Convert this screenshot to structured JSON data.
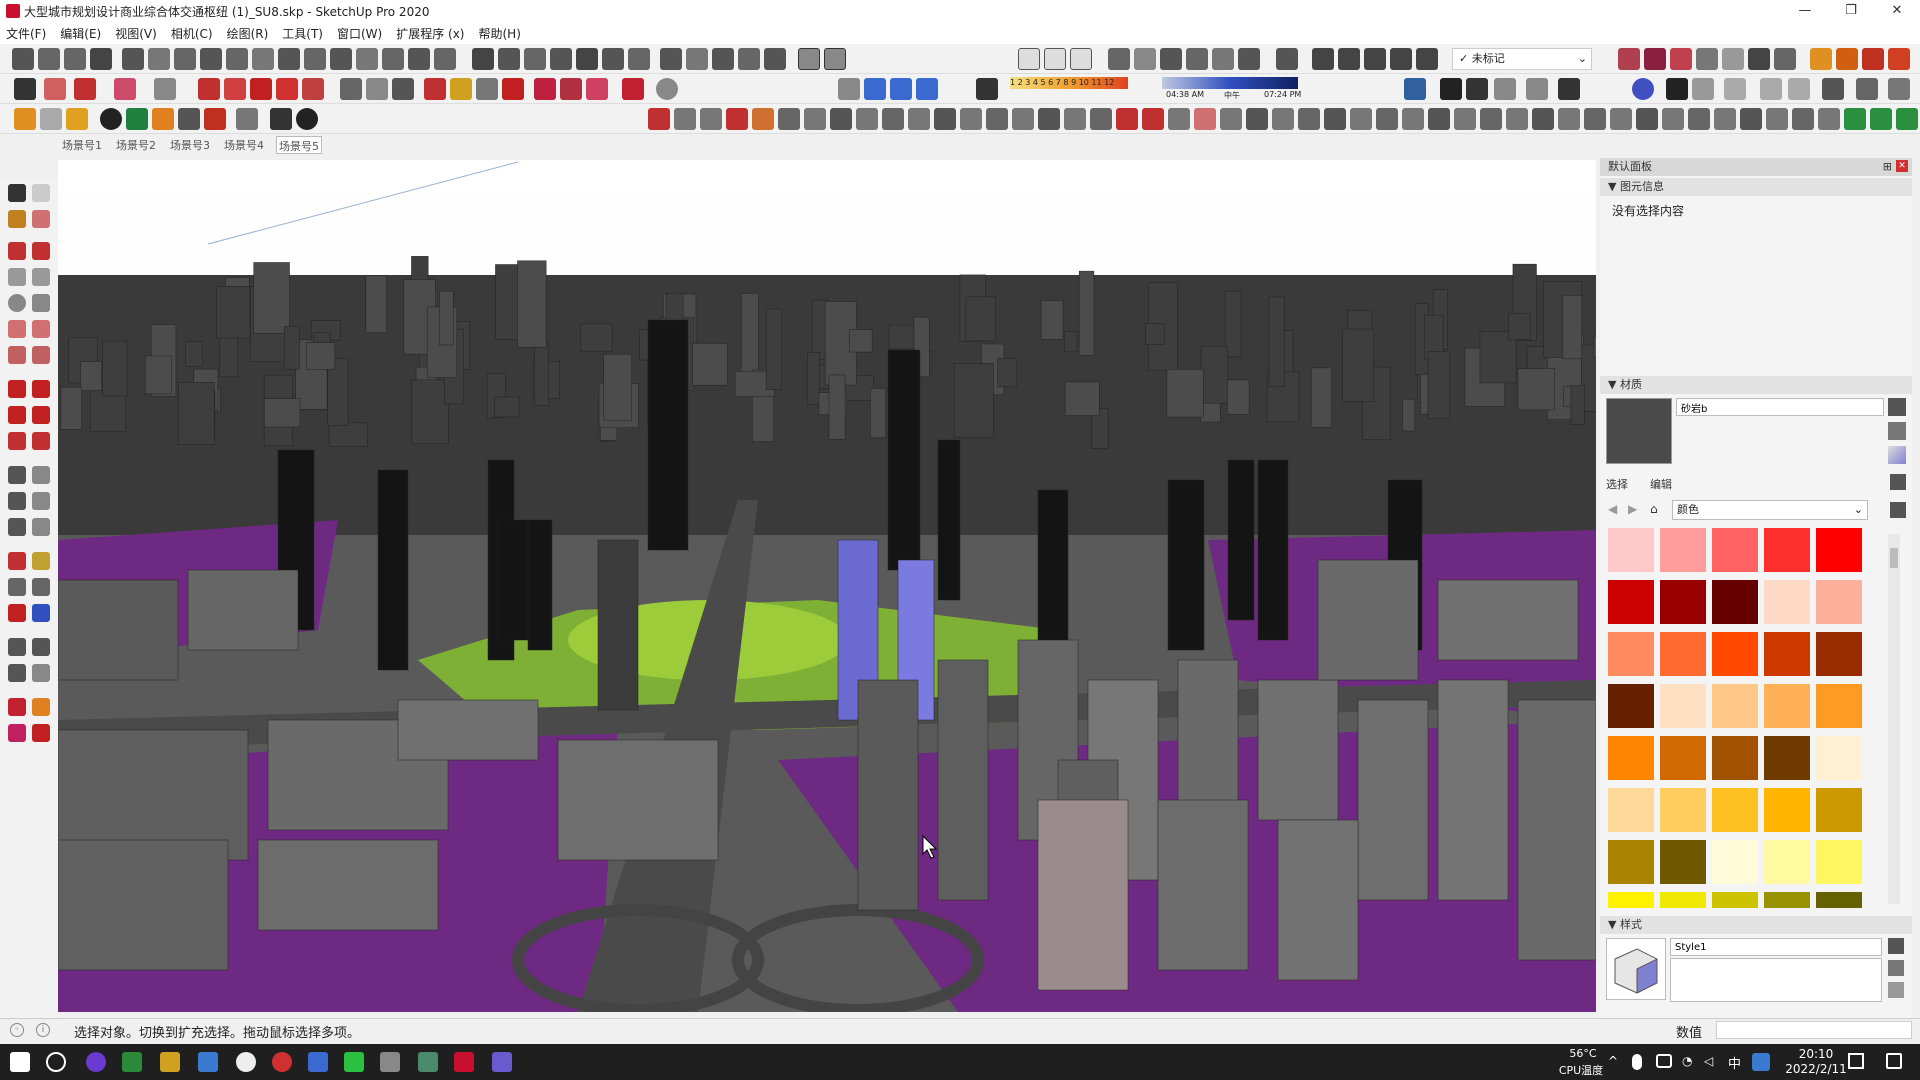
{
  "window": {
    "title": "大型城市规划设计商业综合体交通枢纽 (1)_SU8.skp - SketchUp Pro 2020",
    "min_label": "—",
    "max_label": "❐",
    "close_label": "✕"
  },
  "menu": {
    "items": [
      "文件(F)",
      "编辑(E)",
      "视图(V)",
      "相机(C)",
      "绘图(R)",
      "工具(T)",
      "窗口(W)",
      "扩展程序 (x)",
      "帮助(H)"
    ]
  },
  "toolbar": {
    "tag_label": "未标记",
    "shadow_months": "1 2 3 4 5 6 7 8 9 10 11 12",
    "shadow_time_start": "04:38 AM",
    "shadow_time_mid": "中午",
    "shadow_time_end": "07:24 PM"
  },
  "scenes": {
    "tabs": [
      "场景号1",
      "场景号2",
      "场景号3",
      "场景号4",
      "场景号5"
    ],
    "active_index": 4
  },
  "panel": {
    "tray_title": "默认面板",
    "entity_info": {
      "header": "图元信息",
      "empty_text": "没有选择内容"
    },
    "materials": {
      "header": "材质",
      "material_name": "砂岩b",
      "tab_select": "选择",
      "tab_edit": "编辑",
      "library": "颜色",
      "swatches": [
        "#ffc9c9",
        "#ff9d9d",
        "#ff6262",
        "#ff2e2e",
        "#ff0000",
        "#cc0000",
        "#990000",
        "#660000",
        "#ffd8c6",
        "#ffb09a",
        "#ff8b5e",
        "#ff6a31",
        "#ff4800",
        "#cc3a00",
        "#992d00",
        "#662100",
        "#ffe0c2",
        "#ffc889",
        "#ffb156",
        "#ff9a22",
        "#ff8400",
        "#d06a00",
        "#a05200",
        "#6e3a00",
        "#fff0d4",
        "#ffd99a",
        "#ffcc5e",
        "#ffc122",
        "#ffb400",
        "#cc9900",
        "#aa8300",
        "#6e5800",
        "#fffbd8",
        "#fffaa0",
        "#fff762",
        "#fff200",
        "#f0e800",
        "#ccc400",
        "#999200",
        "#666100"
      ]
    },
    "styles": {
      "header": "样式",
      "style_name": "Style1"
    }
  },
  "statusbar": {
    "message": "选择对象。切换到扩充选择。拖动鼠标选择多项。",
    "measure_label": "数值"
  },
  "taskbar": {
    "temp": "56°C",
    "temp_label": "CPU温度",
    "ime": "中",
    "time": "20:10",
    "date": "2022/2/11"
  },
  "colors": {
    "ground": "#6e2a82",
    "road": "#4a4a4a",
    "building": "#555555",
    "park": "#7fb036",
    "tower": "#141414"
  }
}
